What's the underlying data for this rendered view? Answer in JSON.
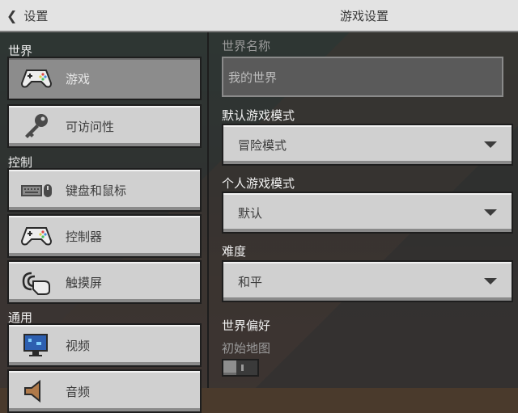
{
  "header": {
    "back_label": "设置",
    "title": "游戏设置"
  },
  "sidebar": {
    "sections": [
      {
        "label": "世界"
      },
      {
        "label": "控制"
      },
      {
        "label": "通用"
      }
    ],
    "items": [
      {
        "label": "游戏",
        "icon": "gamepad-icon",
        "selected": true
      },
      {
        "label": "可访问性",
        "icon": "key-icon",
        "selected": false
      },
      {
        "label": "键盘和鼠标",
        "icon": "keyboard-mouse-icon",
        "selected": false
      },
      {
        "label": "控制器",
        "icon": "controller-icon",
        "selected": false
      },
      {
        "label": "触摸屏",
        "icon": "touch-icon",
        "selected": false
      },
      {
        "label": "视频",
        "icon": "monitor-icon",
        "selected": false
      },
      {
        "label": "音频",
        "icon": "speaker-icon",
        "selected": false
      }
    ]
  },
  "form": {
    "world_name_label": "世界名称",
    "world_name_value": "我的世界",
    "default_mode_label": "默认游戏模式",
    "default_mode_value": "冒险模式",
    "personal_mode_label": "个人游戏模式",
    "personal_mode_value": "默认",
    "difficulty_label": "难度",
    "difficulty_value": "和平",
    "world_prefs_label": "世界偏好",
    "starting_map_label": "初始地图",
    "starting_map_enabled": false
  },
  "colors": {
    "button_bg": "#d0d0d0",
    "selected_bg": "#8c8c8c",
    "panel_bg": "#2c3032"
  }
}
